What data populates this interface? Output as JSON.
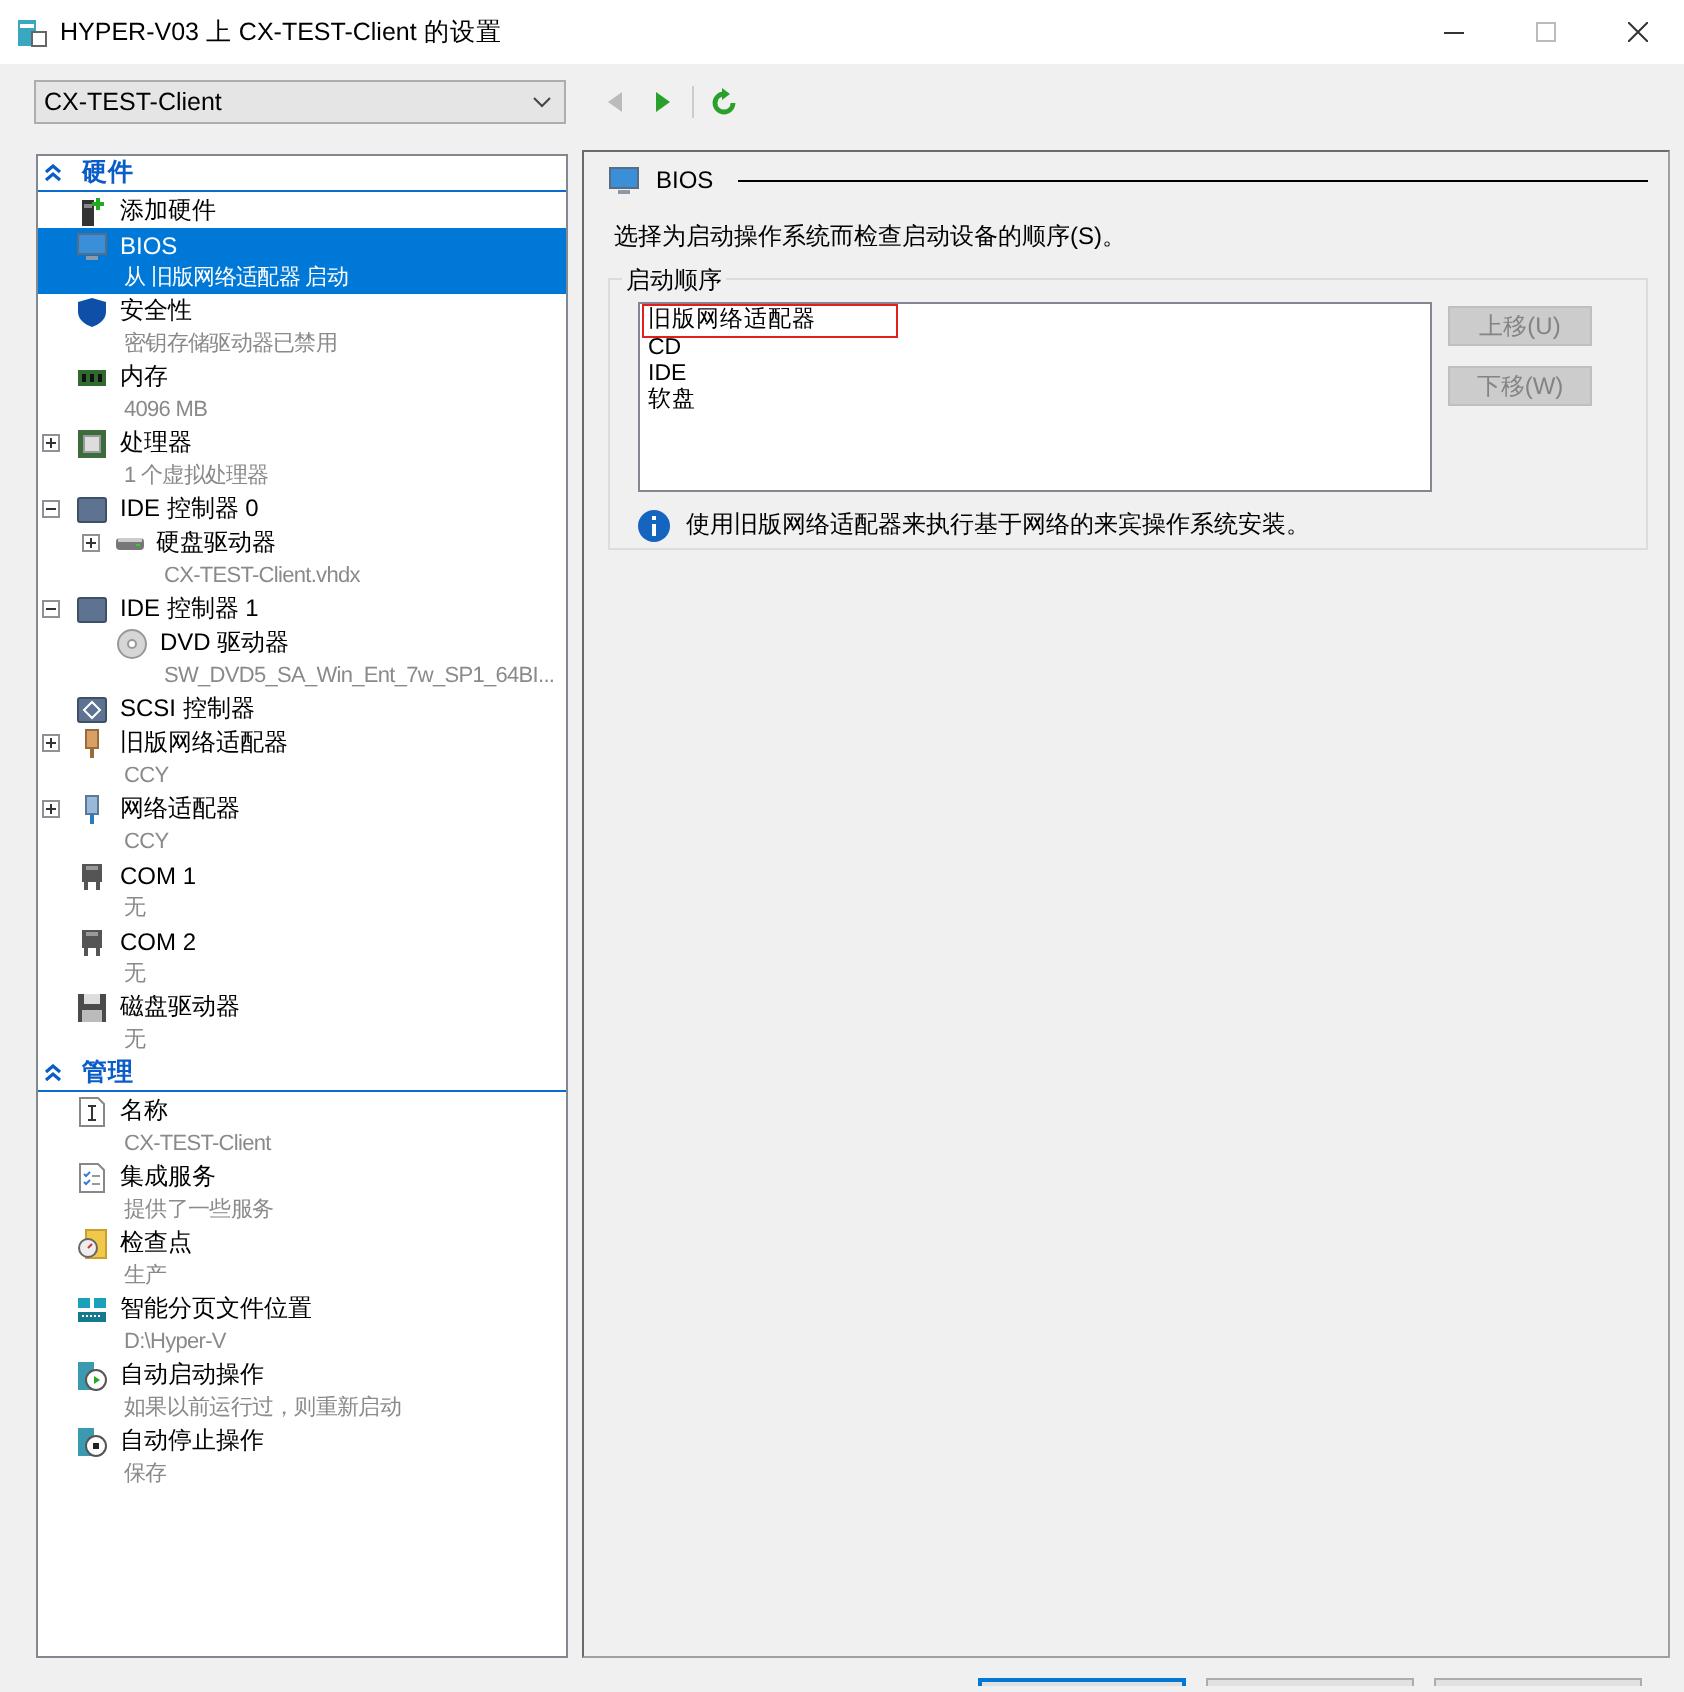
{
  "window": {
    "title": "HYPER-V03 上 CX-TEST-Client 的设置"
  },
  "vm_select": {
    "value": "CX-TEST-Client"
  },
  "toolbar": [
    {
      "kind": "back",
      "disabled": true
    },
    {
      "kind": "forward",
      "disabled": false
    },
    {
      "kind": "refresh",
      "disabled": false
    }
  ],
  "sidebar": {
    "sections": [
      {
        "title": "硬件",
        "expanded": true,
        "items": [
          {
            "kind": "add",
            "label": "添加硬件",
            "selected": false
          },
          {
            "kind": "monitor",
            "label": "BIOS",
            "detail": "从 旧版网络适配器 启动",
            "selected": true
          },
          {
            "kind": "shield",
            "label": "安全性",
            "detail": "密钥存储驱动器已禁用",
            "selected": false
          },
          {
            "kind": "memory",
            "label": "内存",
            "detail": "4096 MB",
            "selected": false
          },
          {
            "kind": "cpu",
            "label": "处理器",
            "detail": "1 个虚拟处理器",
            "selected": false,
            "expanded": false
          },
          {
            "kind": "controller",
            "label": "IDE 控制器 0",
            "selected": false,
            "expanded": true,
            "children": [
              {
                "kind": "disk",
                "label": "硬盘驱动器",
                "detail": "CX-TEST-Client.vhdx",
                "selected": false,
                "expanded": false
              }
            ]
          },
          {
            "kind": "controller",
            "label": "IDE 控制器 1",
            "selected": false,
            "expanded": true,
            "children": [
              {
                "kind": "dvd",
                "label": "DVD 驱动器",
                "detail": "SW_DVD5_SA_Win_Ent_7w_SP1_64BI...",
                "selected": false
              }
            ]
          },
          {
            "kind": "scsi",
            "label": "SCSI 控制器",
            "selected": false
          },
          {
            "kind": "legacy-nic",
            "label": "旧版网络适配器",
            "detail": "CCY",
            "selected": false,
            "expanded": false
          },
          {
            "kind": "nic",
            "label": "网络适配器",
            "detail": "CCY",
            "selected": false,
            "expanded": false
          },
          {
            "kind": "com",
            "label": "COM 1",
            "detail": "无",
            "selected": false
          },
          {
            "kind": "com",
            "label": "COM 2",
            "detail": "无",
            "selected": false
          },
          {
            "kind": "floppy",
            "label": "磁盘驱动器",
            "detail": "无",
            "selected": false
          }
        ]
      },
      {
        "title": "管理",
        "expanded": true,
        "items": [
          {
            "kind": "name",
            "label": "名称",
            "detail": "CX-TEST-Client",
            "selected": false
          },
          {
            "kind": "services",
            "label": "集成服务",
            "detail": "提供了一些服务",
            "selected": false
          },
          {
            "kind": "checkpoint",
            "label": "检查点",
            "detail": "生产",
            "selected": false
          },
          {
            "kind": "paging",
            "label": "智能分页文件位置",
            "detail": "D:\\Hyper-V",
            "selected": false
          },
          {
            "kind": "autostart",
            "label": "自动启动操作",
            "detail": "如果以前运行过，则重新启动",
            "selected": false
          },
          {
            "kind": "autostop",
            "label": "自动停止操作",
            "detail": "保存",
            "selected": false
          }
        ]
      }
    ]
  },
  "panel": {
    "title": "BIOS",
    "description": "选择为启动操作系统而检查启动设备的顺序(S)。",
    "group_title": "启动顺序",
    "boot_order": [
      {
        "label": "旧版网络适配器",
        "annotated": true
      },
      {
        "label": "CD",
        "annotated": false
      },
      {
        "label": "IDE",
        "annotated": false
      },
      {
        "label": "软盘",
        "annotated": false
      }
    ],
    "buttons": [
      {
        "label": "上移(U)",
        "disabled": true
      },
      {
        "label": "下移(W)",
        "disabled": true
      }
    ],
    "info": "使用旧版网络适配器来执行基于网络的来宾操作系统安装。"
  },
  "dialog_buttons": [
    {
      "default": true
    },
    {
      "default": false
    },
    {
      "default": false
    }
  ]
}
